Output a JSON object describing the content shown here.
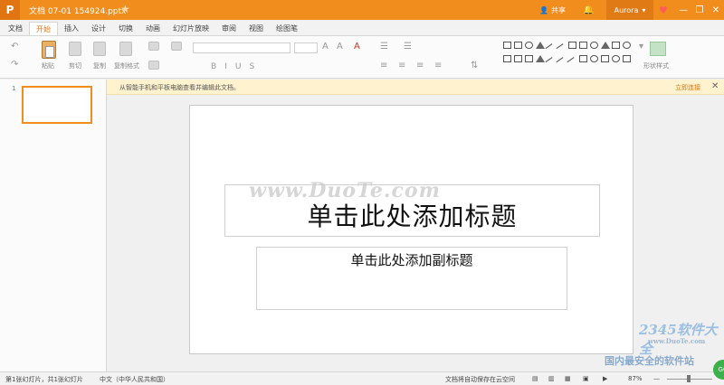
{
  "titlebar": {
    "logo": "P",
    "document_title": "文档 07-01 154924.pptx",
    "star_icon": "★",
    "share_label": "共享",
    "user_name": "Aurora",
    "window_buttons": [
      "—",
      "❐",
      "✕"
    ]
  },
  "menu": {
    "tabs": [
      "文档",
      "开始",
      "插入",
      "设计",
      "切换",
      "动画",
      "幻灯片放映",
      "审阅",
      "视图",
      "绘图笔"
    ],
    "active": "开始"
  },
  "ribbon": {
    "undo_icon": "↶",
    "redo_icon": "↷",
    "paste_label": "粘贴",
    "cut_label": "剪切",
    "copy_label": "复制",
    "format_painter_label": "复制格式",
    "shape_style_label": "形状样式",
    "font_name": "",
    "font_size": "",
    "format_buttons": [
      "B",
      "I",
      "U",
      "S"
    ]
  },
  "notification": {
    "text": "从智能手机和平板电脑查看并编辑此文档。",
    "link": "立即连接",
    "close_icon": "✕"
  },
  "slides_panel": {
    "slide_number": "1"
  },
  "slide": {
    "title_placeholder": "单击此处添加标题",
    "subtitle_placeholder": "单击此处添加副标题"
  },
  "watermarks": {
    "center": "www.DuoTe.com",
    "corner_logo": "2345软件大全",
    "corner_url": "www.DuoTe.com",
    "corner_text": "国内最安全的软件站"
  },
  "statusbar": {
    "slide_info": "第1张幻灯片，共1张幻灯片",
    "language": "中文（中华人民共和国）",
    "autosave": "文档将自动保存在云空间",
    "zoom": "87%",
    "zoom_out": "—",
    "zoom_in": "+",
    "badge": "GO"
  },
  "colors": {
    "accent": "#f08d1c",
    "title_bar": "#f08d1c",
    "notify_bg": "#fff3cf"
  }
}
